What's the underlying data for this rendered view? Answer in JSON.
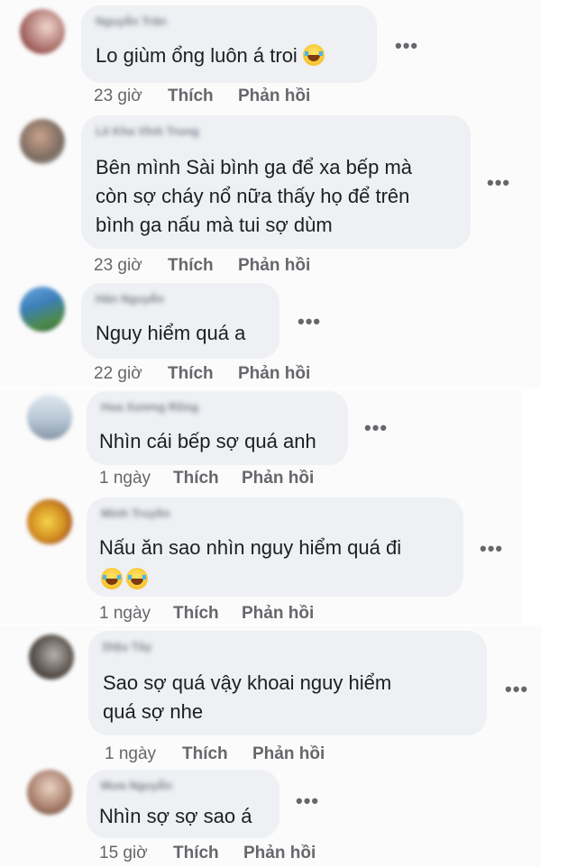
{
  "comments": [
    {
      "author": "Nguyễn Trân",
      "lines": [
        "Lo giùm ổng luôn á troi"
      ],
      "emoji_inline": "laughing-tears",
      "time": "23 giờ",
      "like_label": "Thích",
      "reply_label": "Phản hồi"
    },
    {
      "author": "Lê Kha Vĩnh Trung",
      "lines": [
        "Bên mình Sài bình ga để xa bếp mà",
        "còn sợ cháy nổ nữa thấy họ để trên",
        "bình ga nấu mà tui sợ dùm"
      ],
      "time": "23 giờ",
      "like_label": "Thích",
      "reply_label": "Phản hồi"
    },
    {
      "author": "Hân Nguyễn",
      "lines": [
        "Nguy hiểm quá a"
      ],
      "time": "22 giờ",
      "like_label": "Thích",
      "reply_label": "Phản hồi"
    },
    {
      "author": "Hoa Xương Rồng",
      "lines": [
        "Nhìn cái bếp sợ quá anh"
      ],
      "time": "1 ngày",
      "like_label": "Thích",
      "reply_label": "Phản hồi"
    },
    {
      "author": "Minh Truyền",
      "lines": [
        "Nấu ăn sao nhìn nguy hiểm quá đi"
      ],
      "emoji_row": [
        "laughing-tears",
        "laughing-tears"
      ],
      "time": "1 ngày",
      "like_label": "Thích",
      "reply_label": "Phản hồi"
    },
    {
      "author": "Diệu Tây",
      "lines": [
        "Sao sợ quá vậy khoai nguy hiểm",
        "quá sợ nhe"
      ],
      "time": "1 ngày",
      "like_label": "Thích",
      "reply_label": "Phản hồi"
    },
    {
      "author": "Mưa Nguyễn",
      "lines": [
        "Nhìn sợ sợ sao á"
      ],
      "time": "15 giờ",
      "like_label": "Thích",
      "reply_label": "Phản hồi"
    }
  ],
  "more_label": "•••",
  "colors": {
    "bubble": "#eef0f3",
    "meta_text": "#65676b",
    "comment_text": "#1c1e21"
  }
}
